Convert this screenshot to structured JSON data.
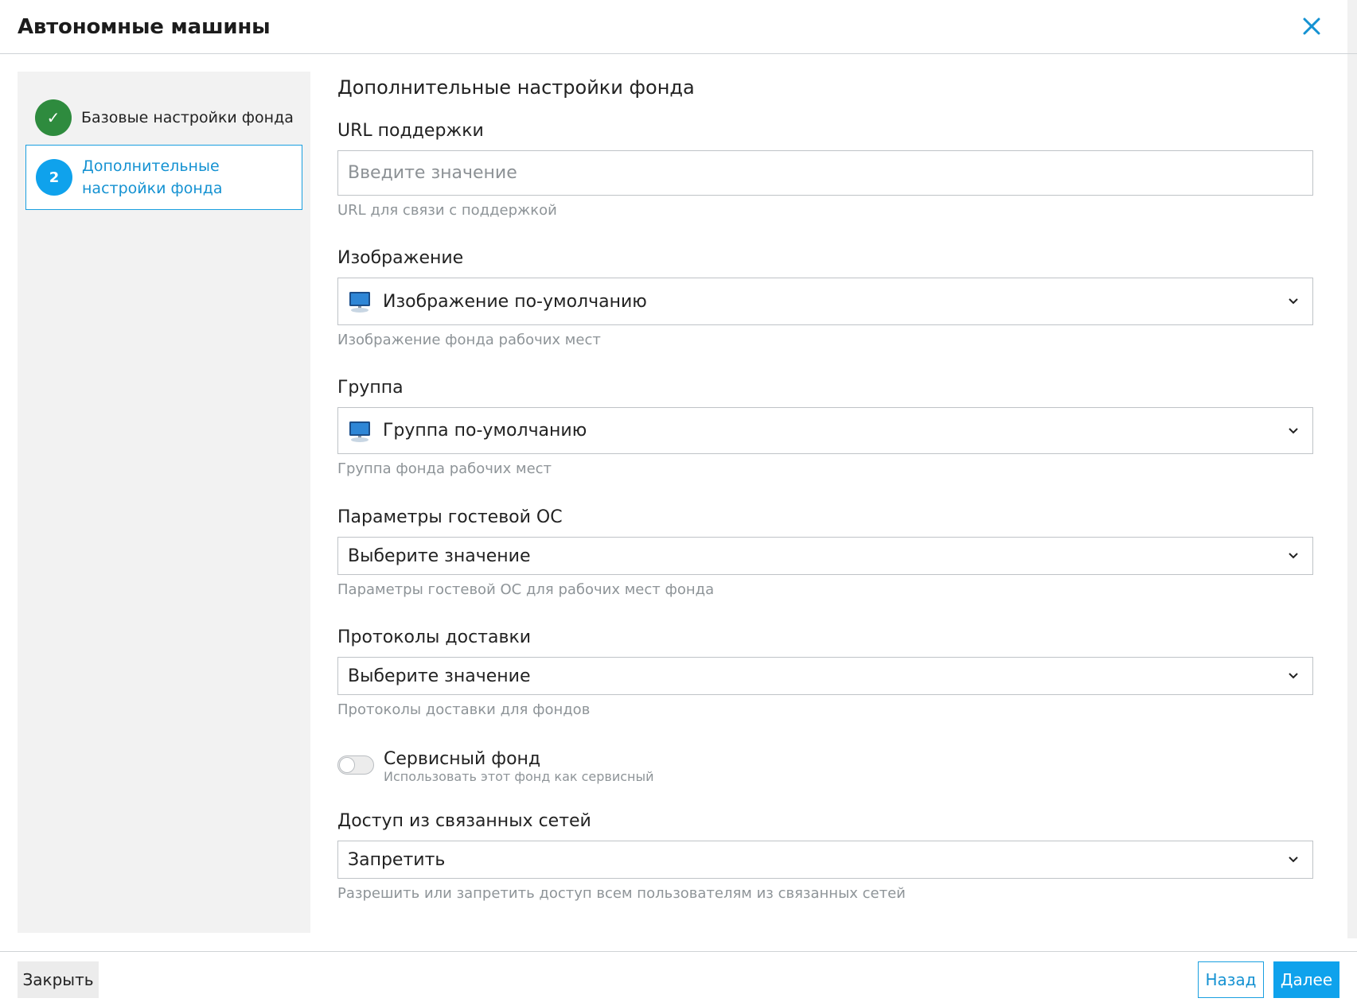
{
  "header": {
    "title": "Автономные машины",
    "close_icon": "close-icon"
  },
  "wizard": {
    "steps": [
      {
        "number": "✓",
        "label": "Базовые настройки фонда",
        "state": "done"
      },
      {
        "number": "2",
        "label": "Дополнительные настройки фонда",
        "state": "active"
      }
    ]
  },
  "form": {
    "section_title": "Дополнительные настройки фонда",
    "support_url": {
      "label": "URL поддержки",
      "placeholder": "Введите значение",
      "hint": "URL для связи с поддержкой"
    },
    "image": {
      "label": "Изображение",
      "value": "Изображение по-умолчанию",
      "hint": "Изображение фонда рабочих мест",
      "icon": "monitor-icon"
    },
    "group": {
      "label": "Группа",
      "value": "Группа по-умолчанию",
      "hint": "Группа фонда рабочих мест",
      "icon": "monitor-icon"
    },
    "guest_os": {
      "label": "Параметры гостевой ОС",
      "value": "Выберите значение",
      "hint": "Параметры гостевой ОС для рабочих мест фонда"
    },
    "protocols": {
      "label": "Протоколы доставки",
      "value": "Выберите значение",
      "hint": "Протоколы доставки для фондов"
    },
    "service_pool": {
      "label": "Сервисный фонд",
      "hint": "Использовать этот фонд как сервисный",
      "enabled": false
    },
    "linked_networks": {
      "label": "Доступ из связанных сетей",
      "value": "Запретить",
      "hint": "Разрешить или запретить доступ всем пользователям из связанных сетей"
    }
  },
  "footer": {
    "close_label": "Закрыть",
    "back_label": "Назад",
    "next_label": "Далее"
  },
  "colors": {
    "accent": "#0fa2ec",
    "success": "#2e8b3e",
    "border": "#bfc3c7",
    "hint": "#8e9498"
  }
}
